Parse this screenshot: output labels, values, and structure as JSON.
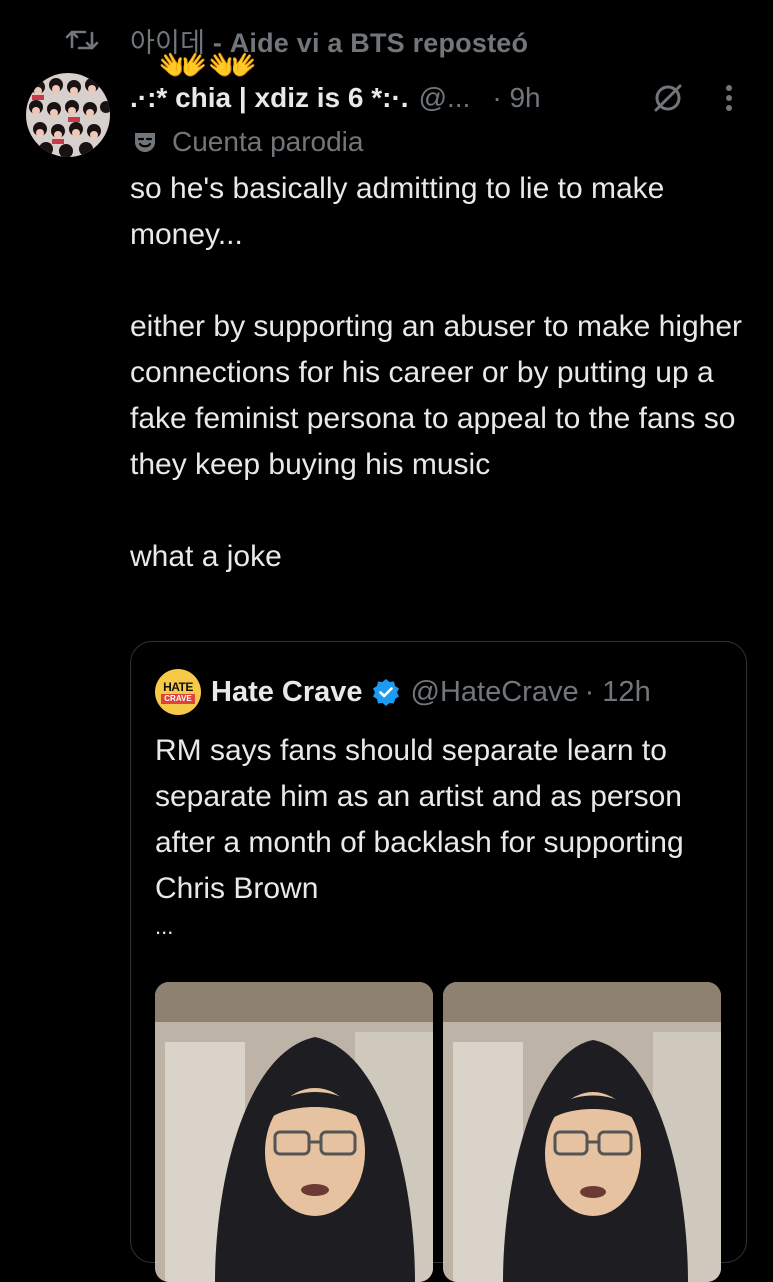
{
  "repost": {
    "icon": "repost-icon",
    "user_korean": "아이데",
    "text": " - Aide vi a BTS reposteó",
    "emoji": "👐"
  },
  "tweet": {
    "avatar": "avatar-collage",
    "display_name": ".·:* chia | xdiz is 6 *:·.",
    "handle": "@...",
    "time": "· 9h",
    "label_icon": "mask-icon",
    "label": "Cuenta parodia",
    "paragraphs": [
      "so he's basically admitting to lie to make money...",
      "either by supporting an abuser to make higher connections for his career or by putting up a fake feminist persona to appeal to the fans so they keep buying his music",
      "what a joke"
    ]
  },
  "quote": {
    "logo_top": "HATE",
    "logo_bottom": "CRAVE",
    "name": "Hate Crave",
    "verified_color": "#1d9bf0",
    "handle": "@HateCrave",
    "time": "· 12h",
    "text": "RM says fans should separate learn to separate him as an artist and as person after a month of backlash for supporting Chris Brown",
    "ellipsis": "...",
    "media": [
      "video-thumbnail",
      "video-thumbnail"
    ]
  },
  "colors": {
    "background": "#000000",
    "text": "#e7e9ea",
    "muted": "#71767b",
    "border": "#2f3336",
    "accent": "#1d9bf0"
  }
}
